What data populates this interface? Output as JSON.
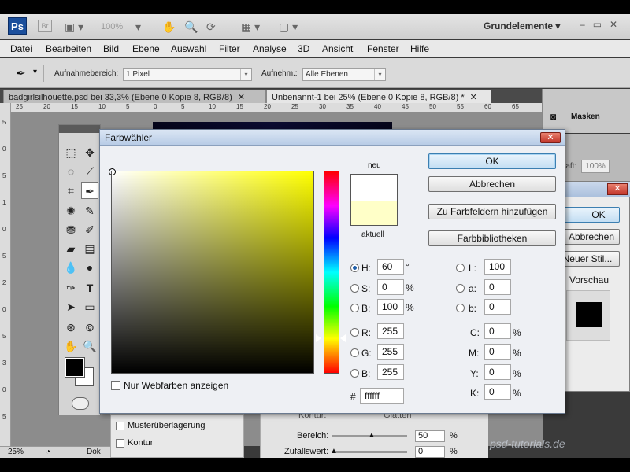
{
  "app": {
    "logo": "Ps",
    "bridge_logo": "Br",
    "zoom": "100%",
    "workspace": "Grundelemente",
    "window_buttons": [
      "–",
      "▭",
      "✕"
    ]
  },
  "menu": [
    "Datei",
    "Bearbeiten",
    "Bild",
    "Ebene",
    "Auswahl",
    "Filter",
    "Analyse",
    "3D",
    "Ansicht",
    "Fenster",
    "Hilfe"
  ],
  "options": {
    "sample_size_label": "Aufnahmebereich:",
    "sample_size_value": "1 Pixel",
    "sample_label": "Aufnehm.:",
    "sample_value": "Alle Ebenen"
  },
  "tabs": [
    {
      "label": "badgirlsilhouette.psd bei 33,3% (Ebene 0 Kopie 8, RGB/8)",
      "close": "✕"
    },
    {
      "label": "Unbenannt-1 bei 25% (Ebene 0 Kopie 8, RGB/8) *",
      "close": "✕"
    }
  ],
  "ruler_top": [
    "25",
    "20",
    "15",
    "10",
    "5",
    "0",
    "5",
    "10",
    "15",
    "20",
    "25",
    "30",
    "35",
    "40",
    "45",
    "50",
    "55",
    "60",
    "65"
  ],
  "ruler_left": [
    "5",
    "0",
    "5",
    "1",
    "0",
    "5",
    "2",
    "0",
    "5",
    "3",
    "0",
    "5"
  ],
  "status": {
    "zoom": "25%",
    "doc": "Dok"
  },
  "right_panel": {
    "masks_label": "Masken",
    "opacity_prefix": "raft:",
    "opacity_value": "100%"
  },
  "layer_style": {
    "ok": "OK",
    "cancel": "Abbrechen",
    "new_style": "Neuer Stil...",
    "preview": "Vorschau"
  },
  "fx_list": [
    "Musterüberlagerung",
    "Kontur"
  ],
  "fx_params": {
    "contour_label": "Kontur:",
    "smooth_label": "Glätten",
    "range_label": "Bereich:",
    "range_value": "50",
    "range_unit": "%",
    "jitter_label": "Zufallswert:",
    "jitter_value": "0",
    "jitter_unit": "%"
  },
  "watermark": "psd-tutorials.de",
  "picker": {
    "title": "Farbwähler",
    "label_new": "neu",
    "label_current": "aktuell",
    "current_color": "#ffffc8",
    "new_color": "#ffffff",
    "buttons": {
      "ok": "OK",
      "cancel": "Abbrechen",
      "add_swatches": "Zu Farbfeldern hinzufügen",
      "libraries": "Farbbibliotheken"
    },
    "hsb": {
      "h": {
        "label": "H:",
        "value": "60",
        "unit": "°",
        "selected": true
      },
      "s": {
        "label": "S:",
        "value": "0",
        "unit": "%"
      },
      "b": {
        "label": "B:",
        "value": "100",
        "unit": "%"
      }
    },
    "rgb": {
      "r": {
        "label": "R:",
        "value": "255"
      },
      "g": {
        "label": "G:",
        "value": "255"
      },
      "b": {
        "label": "B:",
        "value": "255"
      }
    },
    "lab": {
      "l": {
        "label": "L:",
        "value": "100"
      },
      "a": {
        "label": "a:",
        "value": "0"
      },
      "b": {
        "label": "b:",
        "value": "0"
      }
    },
    "cmyk": {
      "c": {
        "label": "C:",
        "value": "0",
        "unit": "%"
      },
      "m": {
        "label": "M:",
        "value": "0",
        "unit": "%"
      },
      "y": {
        "label": "Y:",
        "value": "0",
        "unit": "%"
      },
      "k": {
        "label": "K:",
        "value": "0",
        "unit": "%"
      }
    },
    "hex_symbol": "#",
    "hex": "ffffff",
    "web_only": "Nur Webfarben anzeigen"
  }
}
